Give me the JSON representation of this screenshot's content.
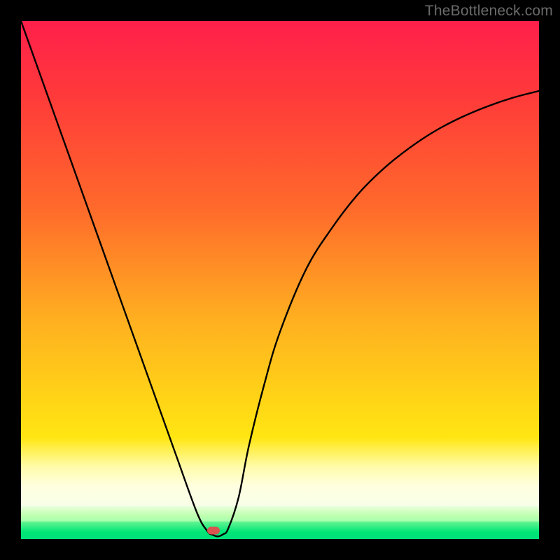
{
  "watermark": {
    "text": "TheBottleneck.com"
  },
  "chart_data": {
    "type": "line",
    "title": "",
    "xlabel": "",
    "ylabel": "",
    "xlim": [
      0,
      100
    ],
    "ylim": [
      0,
      100
    ],
    "grid": false,
    "series": [
      {
        "name": "bottleneck-curve",
        "x": [
          0,
          5,
          10,
          15,
          20,
          25,
          30,
          34,
          36,
          37,
          38,
          39,
          40,
          42,
          44,
          47,
          50,
          55,
          60,
          65,
          70,
          75,
          80,
          85,
          90,
          95,
          100
        ],
        "values": [
          100,
          86,
          72,
          58,
          44,
          30,
          16,
          5,
          1.5,
          0.8,
          0.5,
          0.9,
          2,
          8,
          18,
          30,
          40,
          52,
          60,
          66.5,
          71.5,
          75.5,
          78.8,
          81.4,
          83.5,
          85.2,
          86.5
        ]
      }
    ],
    "marker": {
      "x": 37.2,
      "y": 1.6,
      "color": "#d9534f"
    },
    "background": {
      "type": "vertical-gradient",
      "stops": [
        {
          "pos": 0,
          "color": "#ff1f4b"
        },
        {
          "pos": 0.55,
          "color": "#ff8f20"
        },
        {
          "pos": 0.8,
          "color": "#ffe612"
        },
        {
          "pos": 0.9,
          "color": "#fffcaa"
        },
        {
          "pos": 0.945,
          "color": "#d9ffc4"
        },
        {
          "pos": 0.97,
          "color": "#66f592"
        },
        {
          "pos": 1.0,
          "color": "#00e07a"
        }
      ]
    }
  }
}
